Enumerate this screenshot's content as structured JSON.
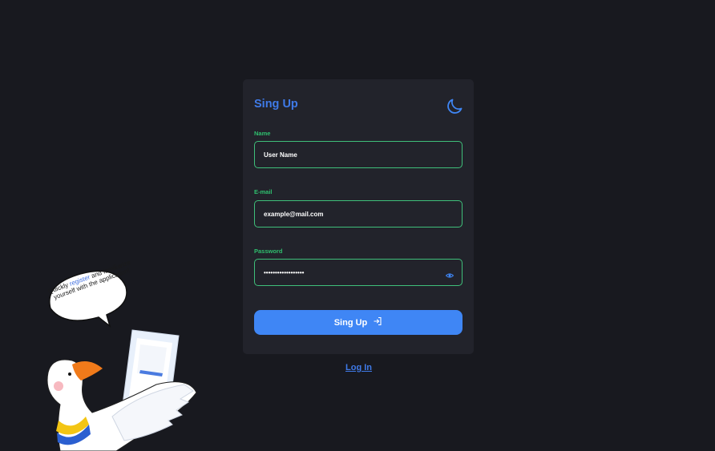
{
  "form": {
    "title": "Sing Up",
    "theme_icon": "moon-icon",
    "fields": {
      "name": {
        "label": "Name",
        "placeholder": "User Name"
      },
      "email": {
        "label": "E-mail",
        "placeholder": "example@mail.com"
      },
      "password": {
        "label": "Password",
        "value": "••••••••••••••••••",
        "toggle_icon": "eye-icon"
      }
    },
    "submit_label": "Sing Up",
    "submit_icon": "login-arrow-icon"
  },
  "login_link": "Log In",
  "illustration": {
    "bubble_part1": "Quickly ",
    "bubble_highlight": "register",
    "bubble_part2": " and familiarize yourself with the application!"
  },
  "colors": {
    "background": "#18191f",
    "card": "#22232b",
    "accent_blue": "#3f86f5",
    "label_green": "#2fbf6e",
    "border_green": "#3fbf7a"
  }
}
